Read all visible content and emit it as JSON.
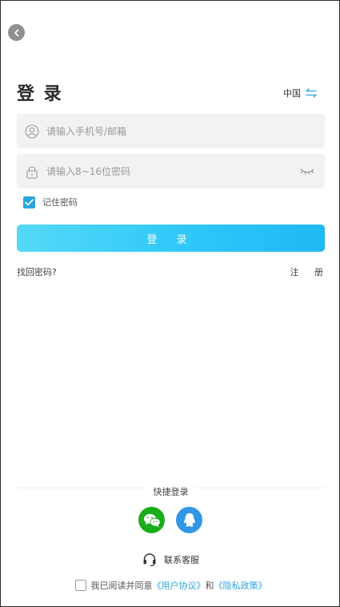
{
  "header": {
    "title": "登 录",
    "region": "中国"
  },
  "form": {
    "phone_placeholder": "请输入手机号/邮箱",
    "password_placeholder": "请输入8~16位密码",
    "remember_label": "记住密码",
    "remember_checked": true,
    "login_label": "登 录"
  },
  "links": {
    "forgot": "找回密码?",
    "register": "注 册"
  },
  "quick_login": {
    "title": "快捷登录",
    "providers": [
      {
        "name": "wechat-icon",
        "color": "#1aad19"
      },
      {
        "name": "qq-icon",
        "color": "#2f97e6"
      }
    ]
  },
  "support": {
    "label": "联系客服"
  },
  "agreement": {
    "prefix": "我已阅读并同意",
    "user_agreement": "《用户协议》",
    "and": "和",
    "privacy_policy": "《隐私政策》",
    "checked": false
  },
  "colors": {
    "accent": "#2ba4e0",
    "button_gradient_start": "#55d9f7",
    "button_gradient_end": "#22b8f4"
  }
}
